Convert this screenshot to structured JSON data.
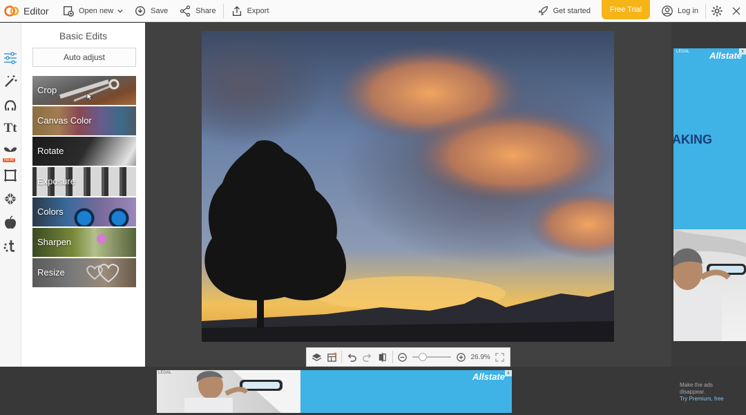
{
  "topbar": {
    "app_title": "Editor",
    "open_new": "Open new",
    "save": "Save",
    "share": "Share",
    "export": "Export",
    "get_started": "Get started",
    "free_trial": "Free Trial",
    "login": "Log in"
  },
  "panel": {
    "title": "Basic Edits",
    "auto_adjust": "Auto adjust",
    "tiles": [
      {
        "label": "Crop"
      },
      {
        "label": "Canvas Color"
      },
      {
        "label": "Rotate"
      },
      {
        "label": "Exposure"
      },
      {
        "label": "Colors"
      },
      {
        "label": "Sharpen"
      },
      {
        "label": "Resize"
      }
    ]
  },
  "rail": {
    "new_badge": "NEW",
    "tt_label": "Tt"
  },
  "toolbar": {
    "zoom_value": "26.9%",
    "zoom_level": 0.27
  },
  "ads": {
    "legal": "LEGAL",
    "brand": "Allstate",
    "side_text": "AKING",
    "close": "x"
  },
  "premium": {
    "line1": "Make the ads",
    "line2": "disappear.",
    "link": "Try Premium, free"
  },
  "colors": {
    "accent": "#3a9ad9",
    "free_trial": "#f6b417",
    "ad_blue": "#3fb2e6"
  }
}
